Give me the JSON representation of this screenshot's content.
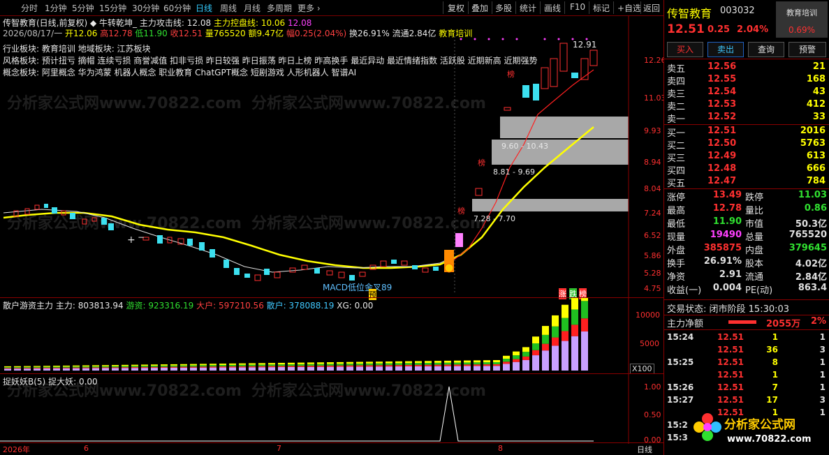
{
  "toolbar": {
    "timeframes": [
      "分时",
      "1分钟",
      "5分钟",
      "15分钟",
      "30分钟",
      "60分钟",
      "日线",
      "周线",
      "月线",
      "多周期",
      "更多 ›"
    ],
    "active_timeframe": "日线",
    "tools": [
      "复权",
      "叠加",
      "多股",
      "统计",
      "画线",
      "F10",
      "标记",
      "+自选",
      "返回"
    ]
  },
  "header": {
    "title": "传智教育(日线,前复权)",
    "indicator_name": "◆ 牛转乾坤_",
    "attack_label": "主力攻击线:",
    "attack_val": "12.08",
    "control_label": "主力控盘线:",
    "control_val": "10.06",
    "extra_val": "12.08",
    "date": "2026/08/17/一",
    "open": "开12.06",
    "high": "高12.78",
    "low": "低11.90",
    "close": "收12.51",
    "vol": "量765520",
    "amount": "额9.47亿",
    "amp": "幅0.25(2.04%)",
    "turnover": "换26.91%",
    "float_cap": "流通2.84亿",
    "tag": "教育培训",
    "industry": "行业板块: 教育培训",
    "region": "地域板块: 江苏板块",
    "style": "风格板块: 预计扭亏 摘帽 连续亏损 商誉减值 扣非亏损 昨日较强 昨日振荡 昨日上榜 昨高换手 最近异动 最近情绪指数 活跃股 近期新高 近期强势",
    "concept": "概念板块: 阿里概念 华为鸿蒙 机器人概念 职业教育 ChatGPT概念 短剧游戏 人形机器人 智谱AI"
  },
  "price_axis": [
    "12.26",
    "11.03",
    "9.93",
    "8.94",
    "8.04",
    "7.24",
    "6.52",
    "5.86",
    "5.28",
    "4.75"
  ],
  "chart_annotations": {
    "high_label": "12.91",
    "zone1": "9.60 - 10.43",
    "zone2": "8.81 - 9.69",
    "zone3": "7.28 - 7.70",
    "macd": "MACD低位金叉89",
    "yu": "预",
    "bang": "榜",
    "zhang": "涨",
    "die": "跌",
    "bang2": "榜"
  },
  "vol_panel": {
    "name": "散户游资主力",
    "main_label": "主力:",
    "main_val": "803813.94",
    "hot_label": "游资:",
    "hot_val": "923316.19",
    "big_label": "大户:",
    "big_val": "597210.56",
    "retail_label": "散户:",
    "retail_val": "378088.19",
    "xg": "XG: 0.00",
    "axis": [
      "10000",
      "5000"
    ],
    "unit": "X100"
  },
  "signal_panel": {
    "name": "捉妖妖B(5)",
    "label": "捉大妖:",
    "val": "0.00",
    "axis": [
      "1.00",
      "0.50",
      "0.00"
    ]
  },
  "date_axis": [
    "2026年",
    "6",
    "7",
    "8"
  ],
  "period_label": "日线",
  "quote": {
    "name": "传智教育",
    "code": "003032",
    "badge": "教育培训",
    "badge_pct": "0.69%",
    "price": "12.51",
    "change": "0.25",
    "pct": "2.04%",
    "buttons": [
      "买入",
      "卖出",
      "查询",
      "预警"
    ],
    "asks": [
      {
        "label": "卖五",
        "price": "12.56",
        "vol": "21"
      },
      {
        "label": "卖四",
        "price": "12.55",
        "vol": "168"
      },
      {
        "label": "卖三",
        "price": "12.54",
        "vol": "43"
      },
      {
        "label": "卖二",
        "price": "12.53",
        "vol": "412"
      },
      {
        "label": "卖一",
        "price": "12.52",
        "vol": "33"
      }
    ],
    "bids": [
      {
        "label": "买一",
        "price": "12.51",
        "vol": "2016"
      },
      {
        "label": "买二",
        "price": "12.50",
        "vol": "5763"
      },
      {
        "label": "买三",
        "price": "12.49",
        "vol": "613"
      },
      {
        "label": "买四",
        "price": "12.48",
        "vol": "666"
      },
      {
        "label": "买五",
        "price": "12.47",
        "vol": "784"
      }
    ],
    "stats": [
      {
        "l1": "涨停",
        "v1": "13.49",
        "c1": "#ff3030",
        "l2": "跌停",
        "v2": "11.03",
        "c2": "#30e030"
      },
      {
        "l1": "最高",
        "v1": "12.78",
        "c1": "#ff3030",
        "l2": "量比",
        "v2": "0.86",
        "c2": "#30e030"
      },
      {
        "l1": "最低",
        "v1": "11.90",
        "c1": "#30e030",
        "l2": "市值",
        "v2": "50.3亿",
        "c2": "#e0e0e0"
      },
      {
        "l1": "现量",
        "v1": "19490",
        "c1": "#ff40ff",
        "l2": "总量",
        "v2": "765520",
        "c2": "#e0e0e0"
      },
      {
        "l1": "外盘",
        "v1": "385875",
        "c1": "#ff3030",
        "l2": "内盘",
        "v2": "379645",
        "c2": "#30e030"
      },
      {
        "l1": "换手",
        "v1": "26.91%",
        "c1": "#e0e0e0",
        "l2": "股本",
        "v2": "4.02亿",
        "c2": "#e0e0e0"
      },
      {
        "l1": "净资",
        "v1": "2.91",
        "c1": "#e0e0e0",
        "l2": "流通",
        "v2": "2.84亿",
        "c2": "#e0e0e0"
      },
      {
        "l1": "收益(一)",
        "v1": "0.004",
        "c1": "#e0e0e0",
        "l2": "PE(动)",
        "v2": "863.4",
        "c2": "#e0e0e0"
      }
    ],
    "trade_status_label": "交易状态:",
    "trade_status": "闭市阶段 15:30:03",
    "net_label": "主力净额",
    "net_val": "2055万",
    "net_pct": "2%",
    "ticks": [
      {
        "t": "15:24",
        "p": "12.51",
        "v": "1",
        "n": "1"
      },
      {
        "t": "",
        "p": "12.51",
        "v": "36",
        "n": "3"
      },
      {
        "t": "15:25",
        "p": "12.51",
        "v": "8",
        "n": "1"
      },
      {
        "t": "",
        "p": "12.51",
        "v": "1",
        "n": "1"
      },
      {
        "t": "15:26",
        "p": "12.51",
        "v": "7",
        "n": "1"
      },
      {
        "t": "15:27",
        "p": "12.51",
        "v": "17",
        "n": "3"
      },
      {
        "t": "",
        "p": "12.51",
        "v": "1",
        "n": "1"
      },
      {
        "t": "15:2",
        "p": "",
        "v": "",
        "n": ""
      },
      {
        "t": "15:3",
        "p": "",
        "v": "",
        "n": ""
      }
    ],
    "logo": "分析家公式网",
    "logo_url": "www.70822.com"
  },
  "watermark": "分析家公式网www.70822.com"
}
